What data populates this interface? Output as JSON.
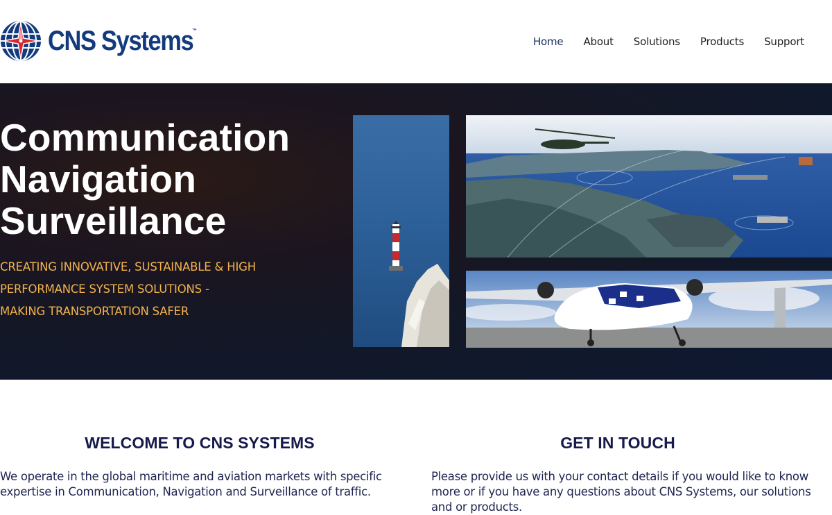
{
  "header": {
    "logo_text": "CNS Systems",
    "logo_tm": "™",
    "nav": [
      {
        "label": "Home"
      },
      {
        "label": "About"
      },
      {
        "label": "Solutions"
      },
      {
        "label": "Products"
      },
      {
        "label": "Support"
      }
    ]
  },
  "hero": {
    "title_lines": [
      "Communication",
      "Navigation",
      "Surveillance"
    ],
    "subtitle_lines": [
      "CREATING INNOVATIVE, SUSTAINABLE & HIGH",
      "PERFORMANCE SYSTEM SOLUTIONS -",
      "MAKING TRANSPORTATION SAFER"
    ]
  },
  "welcome": {
    "heading": "WELCOME TO CNS SYSTEMS",
    "text": "We operate in the global maritime and aviation markets with specific expertise in Communication, Navigation and Surveillance of traffic."
  },
  "contact": {
    "heading": "GET IN TOUCH",
    "text": "Please provide us with your contact details if you would like to know more or if you have any questions about CNS Systems, our solutions and or products."
  },
  "colors": {
    "brand_blue": "#123a7d",
    "accent_red": "#d7282f",
    "hero_subtitle": "#f2b34a",
    "heading_navy": "#161a4a"
  }
}
